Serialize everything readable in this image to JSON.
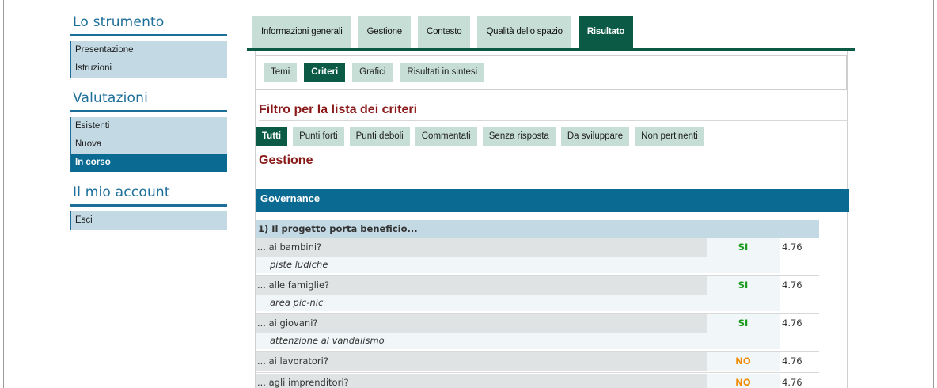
{
  "sidebar": {
    "sections": [
      {
        "heading": "Lo strumento",
        "items": [
          "Presentazione",
          "Istruzioni"
        ]
      },
      {
        "heading": "Valutazioni",
        "items": [
          "Esistenti",
          "Nuova",
          "In corso"
        ]
      },
      {
        "heading": "Il mio account",
        "items": [
          "Esci"
        ]
      }
    ]
  },
  "tabs": [
    "Informazioni generali",
    "Gestione",
    "Contesto",
    "Qualità dello spazio",
    "Risultato"
  ],
  "subtabs": [
    "Temi",
    "Criteri",
    "Grafici",
    "Risultati in sintesi"
  ],
  "filter_title": "Filtro per la lista dei criteri",
  "filters": [
    "Tutti",
    "Punti forti",
    "Punti deboli",
    "Commentati",
    "Senza risposta",
    "Da sviluppare",
    "Non pertinenti"
  ],
  "section_title": "Gestione",
  "group_title": "Governance",
  "question": {
    "title": "1) Il progetto porta beneficio...",
    "rows": [
      {
        "label": "... ai bambini?",
        "answer": "SI",
        "score": "4.76",
        "comment": "piste ludiche"
      },
      {
        "label": "... alle famiglie?",
        "answer": "SI",
        "score": "4.76",
        "comment": "area pic-nic"
      },
      {
        "label": "... ai giovani?",
        "answer": "SI",
        "score": "4.76",
        "comment": "attenzione al vandalismo"
      },
      {
        "label": "... ai lavoratori?",
        "answer": "NO",
        "score": "4.76"
      },
      {
        "label": "... agli imprenditori?",
        "answer": "NO",
        "score": "4.76"
      }
    ]
  },
  "colors": {
    "sidebar_accent": "#1d6f9a",
    "tab_active": "#0b5a45",
    "tab_inactive": "#c6ded6",
    "title_red": "#8a1a1a",
    "answer_si": "#1a9a1a",
    "answer_no": "#f08a00"
  }
}
